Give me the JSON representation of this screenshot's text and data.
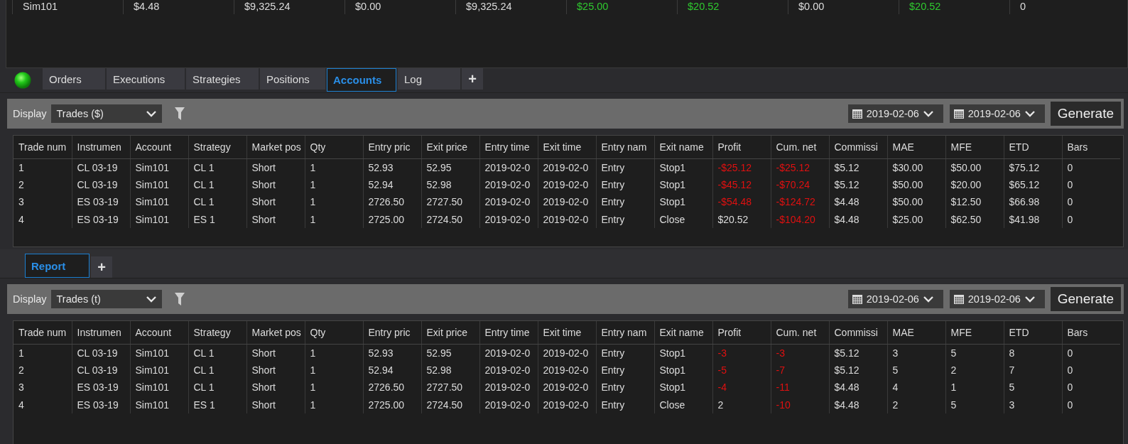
{
  "account_grid": {
    "row": [
      {
        "text": "Sim101"
      },
      {
        "text": "$4.48"
      },
      {
        "text": "$9,325.24"
      },
      {
        "text": "$0.00"
      },
      {
        "text": "$9,325.24"
      },
      {
        "text": "$25.00",
        "color": "#2fc82f"
      },
      {
        "text": "$20.52",
        "color": "#2fc82f"
      },
      {
        "text": "$0.00"
      },
      {
        "text": "$20.52",
        "color": "#2fc82f"
      },
      {
        "text": "0"
      }
    ]
  },
  "tabs": [
    {
      "label": "Orders",
      "selected": false
    },
    {
      "label": "Executions",
      "selected": false
    },
    {
      "label": "Strategies",
      "selected": false
    },
    {
      "label": "Positions",
      "selected": false
    },
    {
      "label": "Accounts",
      "selected": true
    },
    {
      "label": "Log",
      "selected": false
    }
  ],
  "add_tab": "+",
  "accounts_report": {
    "display_label": "Display",
    "display_value": "Trades ($)",
    "start_date": "2019-02-06",
    "end_date": "2019-02-06",
    "generate": "Generate",
    "table": {
      "columns": [
        "Trade num",
        "Instrumen",
        "Account",
        "Strategy",
        "Market pos",
        "Qty",
        "Entry pric",
        "Exit price",
        "Entry time",
        "Exit time",
        "Entry nam",
        "Exit name",
        "Profit",
        "Cum. net",
        "Commissi",
        "MAE",
        "MFE",
        "ETD",
        "Bars"
      ],
      "rows": [
        [
          "1",
          "CL 03-19",
          "Sim101",
          "CL 1",
          "Short",
          "1",
          "52.93",
          "52.95",
          "2019-02-0",
          "2019-02-0",
          "Entry",
          "Stop1",
          {
            "text": "-$25.12",
            "color": "#e01010"
          },
          {
            "text": "-$25.12",
            "color": "#e01010"
          },
          "$5.12",
          "$30.00",
          "$50.00",
          "$75.12",
          "0"
        ],
        [
          "2",
          "CL 03-19",
          "Sim101",
          "CL 1",
          "Short",
          "1",
          "52.94",
          "52.98",
          "2019-02-0",
          "2019-02-0",
          "Entry",
          "Stop1",
          {
            "text": "-$45.12",
            "color": "#e01010"
          },
          {
            "text": "-$70.24",
            "color": "#e01010"
          },
          "$5.12",
          "$50.00",
          "$20.00",
          "$65.12",
          "0"
        ],
        [
          "3",
          "ES 03-19",
          "Sim101",
          "CL 1",
          "Short",
          "1",
          "2726.50",
          "2727.50",
          "2019-02-0",
          "2019-02-0",
          "Entry",
          "Stop1",
          {
            "text": "-$54.48",
            "color": "#e01010"
          },
          {
            "text": "-$124.72",
            "color": "#e01010"
          },
          "$4.48",
          "$50.00",
          "$12.50",
          "$66.98",
          "0"
        ],
        [
          "4",
          "ES 03-19",
          "Sim101",
          "ES 1",
          "Short",
          "1",
          "2725.00",
          "2724.50",
          "2019-02-0",
          "2019-02-0",
          "Entry",
          "Close",
          "$20.52",
          {
            "text": "-$104.20",
            "color": "#e01010"
          },
          "$4.48",
          "$25.00",
          "$62.50",
          "$41.98",
          "0"
        ]
      ]
    }
  },
  "report_tabs": [
    {
      "label": "Report",
      "selected": true
    }
  ],
  "report_add_tab": "+",
  "report": {
    "display_label": "Display",
    "display_value": "Trades (t)",
    "start_date": "2019-02-06",
    "end_date": "2019-02-06",
    "generate": "Generate",
    "table": {
      "columns": [
        "Trade num",
        "Instrumen",
        "Account",
        "Strategy",
        "Market pos",
        "Qty",
        "Entry pric",
        "Exit price",
        "Entry time",
        "Exit time",
        "Entry nam",
        "Exit name",
        "Profit",
        "Cum. net",
        "Commissi",
        "MAE",
        "MFE",
        "ETD",
        "Bars"
      ],
      "rows": [
        [
          "1",
          "CL 03-19",
          "Sim101",
          "CL 1",
          "Short",
          "1",
          "52.93",
          "52.95",
          "2019-02-0",
          "2019-02-0",
          "Entry",
          "Stop1",
          {
            "text": "-3",
            "color": "#e01010"
          },
          {
            "text": "-3",
            "color": "#e01010"
          },
          "$5.12",
          "3",
          "5",
          "8",
          "0"
        ],
        [
          "2",
          "CL 03-19",
          "Sim101",
          "CL 1",
          "Short",
          "1",
          "52.94",
          "52.98",
          "2019-02-0",
          "2019-02-0",
          "Entry",
          "Stop1",
          {
            "text": "-5",
            "color": "#e01010"
          },
          {
            "text": "-7",
            "color": "#e01010"
          },
          "$5.12",
          "5",
          "2",
          "7",
          "0"
        ],
        [
          "3",
          "ES 03-19",
          "Sim101",
          "CL 1",
          "Short",
          "1",
          "2726.50",
          "2727.50",
          "2019-02-0",
          "2019-02-0",
          "Entry",
          "Stop1",
          {
            "text": "-4",
            "color": "#e01010"
          },
          {
            "text": "-11",
            "color": "#e01010"
          },
          "$4.48",
          "4",
          "1",
          "5",
          "0"
        ],
        [
          "4",
          "ES 03-19",
          "Sim101",
          "ES 1",
          "Short",
          "1",
          "2725.00",
          "2724.50",
          "2019-02-0",
          "2019-02-0",
          "Entry",
          "Close",
          "2",
          {
            "text": "-10",
            "color": "#e01010"
          },
          "$4.48",
          "2",
          "5",
          "3",
          "0"
        ]
      ]
    }
  }
}
